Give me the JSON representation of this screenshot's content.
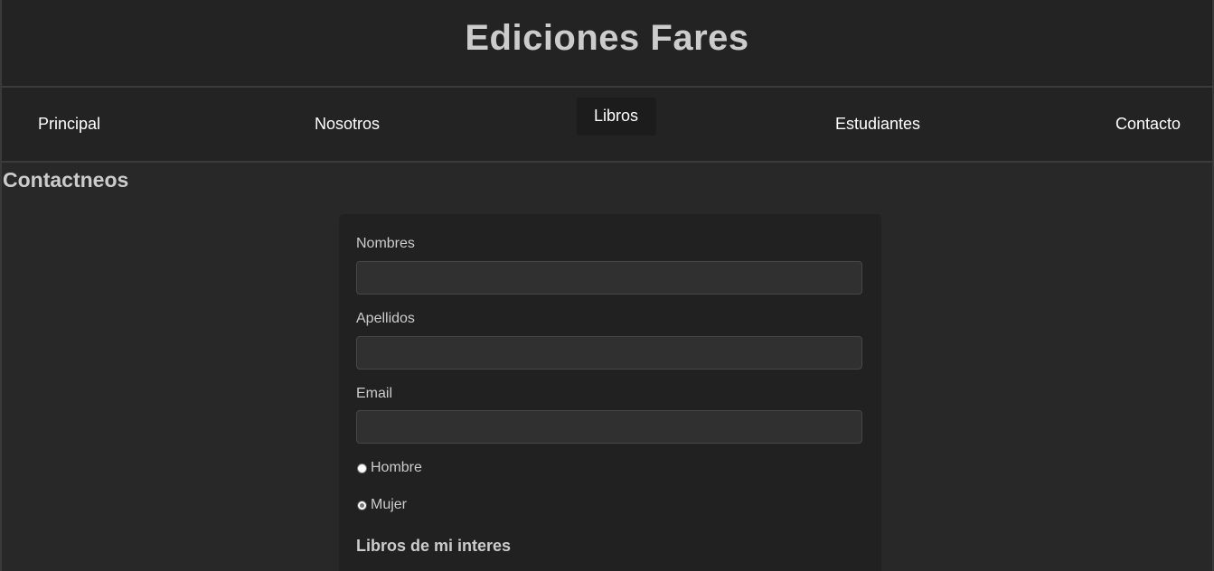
{
  "header": {
    "title": "Ediciones Fares"
  },
  "nav": {
    "items": [
      {
        "label": "Principal"
      },
      {
        "label": "Nosotros"
      },
      {
        "label": "Libros"
      },
      {
        "label": "Estudiantes"
      },
      {
        "label": "Contacto"
      }
    ],
    "active": "Libros"
  },
  "main": {
    "section_title": "Contactneos",
    "form": {
      "fields": [
        {
          "label": "Nombres",
          "value": "",
          "placeholder": ""
        },
        {
          "label": "Apellidos",
          "value": "",
          "placeholder": ""
        },
        {
          "label": "Email",
          "value": "",
          "placeholder": ""
        }
      ],
      "gender_options": [
        {
          "label": "Hombre",
          "checked": false
        },
        {
          "label": "Mujer",
          "checked": true
        }
      ],
      "books_heading": "Libros de mi interes"
    }
  },
  "colors": {
    "page_background": "#282828",
    "header_background": "#232323",
    "card_background": "#212121",
    "input_background": "#303030",
    "heading_text": "#cccccc",
    "nav_text": "#ffffff",
    "active_nav_background": "#1c1c1c"
  }
}
